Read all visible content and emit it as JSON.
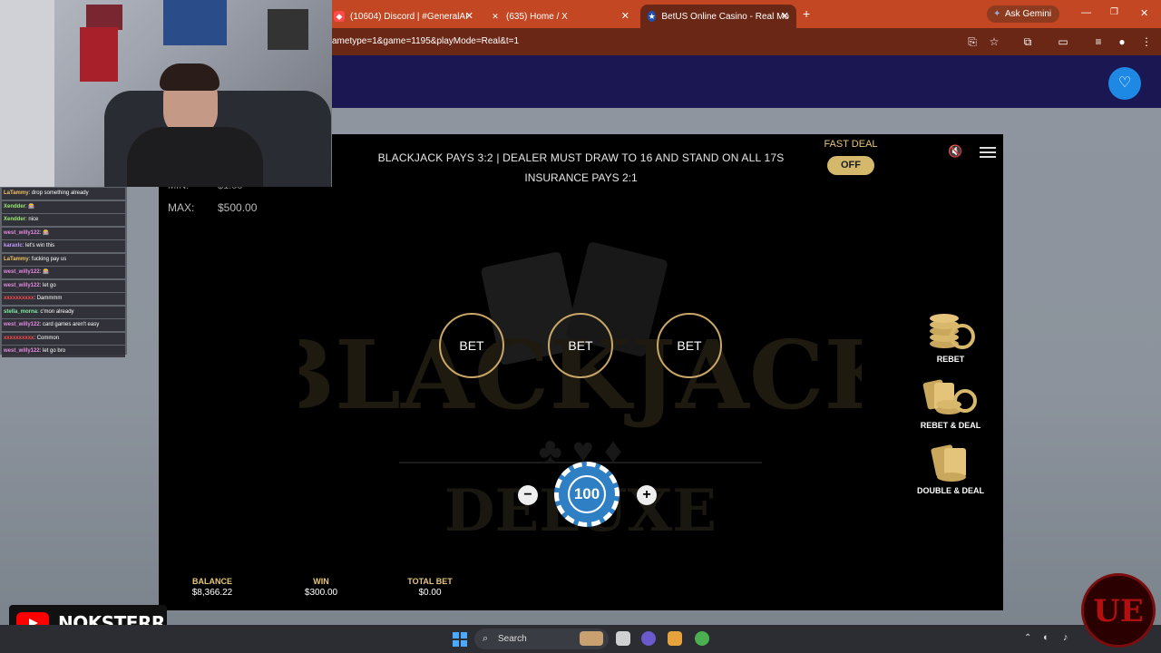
{
  "browser": {
    "tabs": [
      {
        "label": "(10604) Discord | #GeneralAI",
        "favicon": "discord-icon"
      },
      {
        "label": "(635) Home / X",
        "favicon": "x-icon"
      },
      {
        "label": "BetUS Online Casino - Real Mo",
        "favicon": "betus-icon",
        "active": true
      }
    ],
    "new_tab": "+",
    "ask_gemini": "Ask Gemini",
    "url": "ametype=1&game=1195&playMode=Real&t=1",
    "colors": {
      "tabbar": "#c24722",
      "toolbar": "#6b2715"
    }
  },
  "site": {
    "header_color": "#1a1752",
    "favorite_icon": "heart-icon",
    "favorite_color": "#1e88e5"
  },
  "game": {
    "rules_line1": "BLACKJACK PAYS 3:2 | DEALER MUST DRAW TO 16 AND STAND ON ALL 17S",
    "rules_line2": "INSURANCE PAYS 2:1",
    "fast_deal_label": "FAST DEAL",
    "fast_deal_state": "OFF",
    "min_label": "MIN:",
    "min_value": "$1.00",
    "max_label": "MAX:",
    "max_value": "$500.00",
    "logo_text_top": "BLACKJACK",
    "logo_text_bottom": "DELUXE",
    "bet_spots": [
      "BET",
      "BET",
      "BET"
    ],
    "chip_value": "100",
    "minus_label": "−",
    "plus_label": "+",
    "side_actions": [
      {
        "label": "REBET",
        "icon": "rebet-icon"
      },
      {
        "label": "REBET & DEAL",
        "icon": "rebet-deal-icon"
      },
      {
        "label": "DOUBLE & DEAL",
        "icon": "double-deal-icon"
      }
    ],
    "stats": [
      {
        "label": "BALANCE",
        "value": "$8,366.22"
      },
      {
        "label": "WIN",
        "value": "$300.00"
      },
      {
        "label": "TOTAL BET",
        "value": "$0.00"
      }
    ],
    "accent_gold": "#e7c77b"
  },
  "chat": [
    {
      "user": "LaTammy",
      "msg": ": drop something already",
      "color": "#f0c060"
    },
    {
      "user": "Xendder",
      "msg": ": 🎰",
      "color": "#9be870"
    },
    {
      "user": "Xendder",
      "msg": ": nice",
      "color": "#9be870"
    },
    {
      "user": "west_willy122",
      "msg": ": 🎰",
      "color": "#e58be0"
    },
    {
      "user": "karaxlc",
      "msg": ": let's win this",
      "color": "#c79bff"
    },
    {
      "user": "LaTammy",
      "msg": ": fucking pay us",
      "color": "#f0c060"
    },
    {
      "user": "west_willy122",
      "msg": ": 🎰",
      "color": "#e58be0"
    },
    {
      "user": "west_willy122",
      "msg": ": let go",
      "color": "#e58be0"
    },
    {
      "user": "xxxxxxxxxx",
      "msg": ": Dammmm",
      "color": "#ff4a4a"
    },
    {
      "user": "stella_morna",
      "msg": ": c'mon already",
      "color": "#80e8a0"
    },
    {
      "user": "west_willy122",
      "msg": ": card games aren't easy",
      "color": "#e58be0"
    },
    {
      "user": "xxxxxxxxxx",
      "msg": ": Common",
      "color": "#ff4a4a"
    },
    {
      "user": "west_willy122",
      "msg": ": let go bro",
      "color": "#e58be0"
    }
  ],
  "streamer": {
    "platform_icon": "youtube-icon",
    "name": "NOKSTERR"
  },
  "taskbar": {
    "search_label": "Search"
  }
}
